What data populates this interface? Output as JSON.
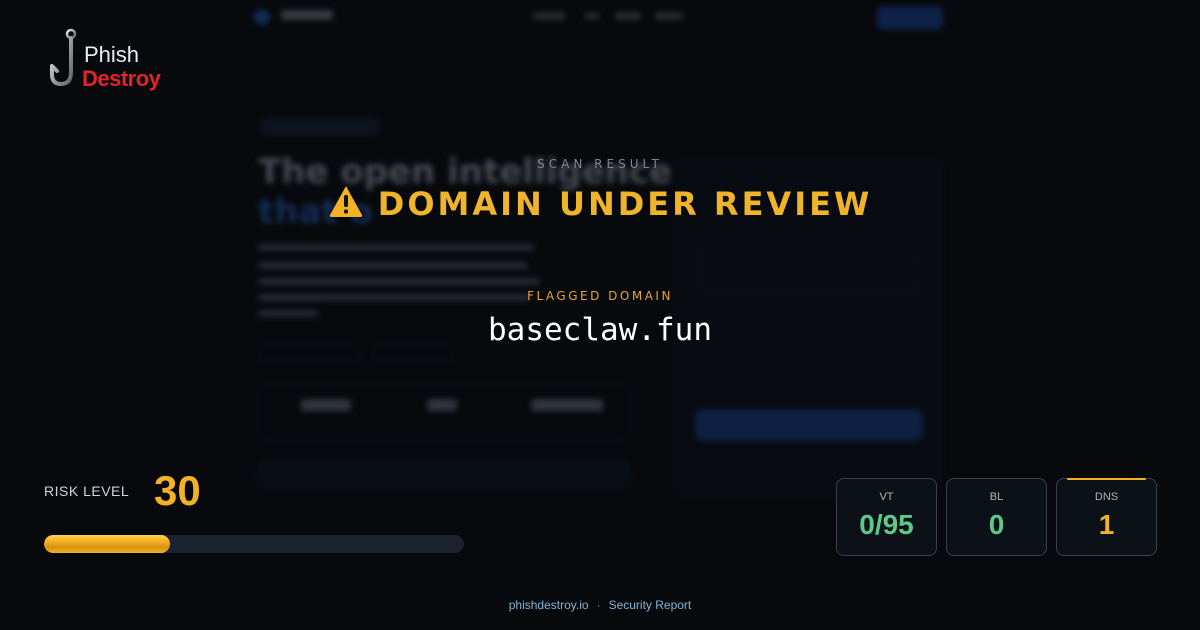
{
  "brand": {
    "name_line1": "Phish",
    "name_line2": "Destroy"
  },
  "scan": {
    "label": "SCAN RESULT",
    "status": "DOMAIN UNDER REVIEW",
    "status_icon": "warning-triangle-icon",
    "status_color": "#f0b42a"
  },
  "flagged": {
    "label": "FLAGGED DOMAIN",
    "domain": "baseclaw.fun"
  },
  "risk": {
    "label": "RISK LEVEL",
    "value": "30",
    "fraction": 0.3,
    "color": "#f2b224"
  },
  "metrics": [
    {
      "label": "VT",
      "value": "0/95",
      "color": "#5cc98a"
    },
    {
      "label": "BL",
      "value": "0",
      "color": "#5cc98a"
    },
    {
      "label": "DNS",
      "value": "1",
      "color": "#f2b224",
      "highlighted": true
    }
  ],
  "footer": {
    "site": "phishdestroy.io",
    "separator": "·",
    "report": "Security Report"
  },
  "background": {
    "headline_line1": "The open intelligence",
    "headline_line2": "that o"
  }
}
